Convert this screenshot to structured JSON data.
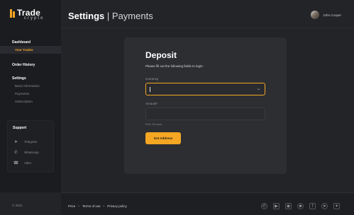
{
  "brand": {
    "title": "Trade",
    "subtitle": "crypto",
    "color": "#f5a623"
  },
  "sidebar": {
    "dashboard": "Dashboard",
    "your_trades": "Your Trades",
    "order_history": "Order History",
    "settings": "Settings",
    "settings_items": [
      "Basic Information",
      "Payments",
      "Subscription"
    ]
  },
  "support": {
    "title": "Support",
    "items": [
      {
        "label": "Telegram",
        "icon": "telegram-icon"
      },
      {
        "label": "WhatsApp",
        "icon": "whatsapp-icon"
      },
      {
        "label": "Viber",
        "icon": "viber-icon"
      }
    ]
  },
  "copyright": "© 2021",
  "header": {
    "title": "Settings",
    "separator": " | ",
    "subtitle": "Payments"
  },
  "user": {
    "name": "John Cooper"
  },
  "deposit": {
    "title": "Deposit",
    "description": "Please fill out the following fields to login:",
    "currency_label": "Currency",
    "currency_value": "",
    "amount_label": "Amount*",
    "amount_value": "",
    "hint": "Fee: 0% plus",
    "button": "Get Address"
  },
  "footer": {
    "links": [
      "Price",
      "Terms of use",
      "Privacy policy"
    ],
    "social": [
      "whatsapp-icon",
      "youtube-icon",
      "instagram-icon",
      "reddit-icon",
      "facebook-icon",
      "telegram-icon",
      "twitter-icon"
    ]
  }
}
